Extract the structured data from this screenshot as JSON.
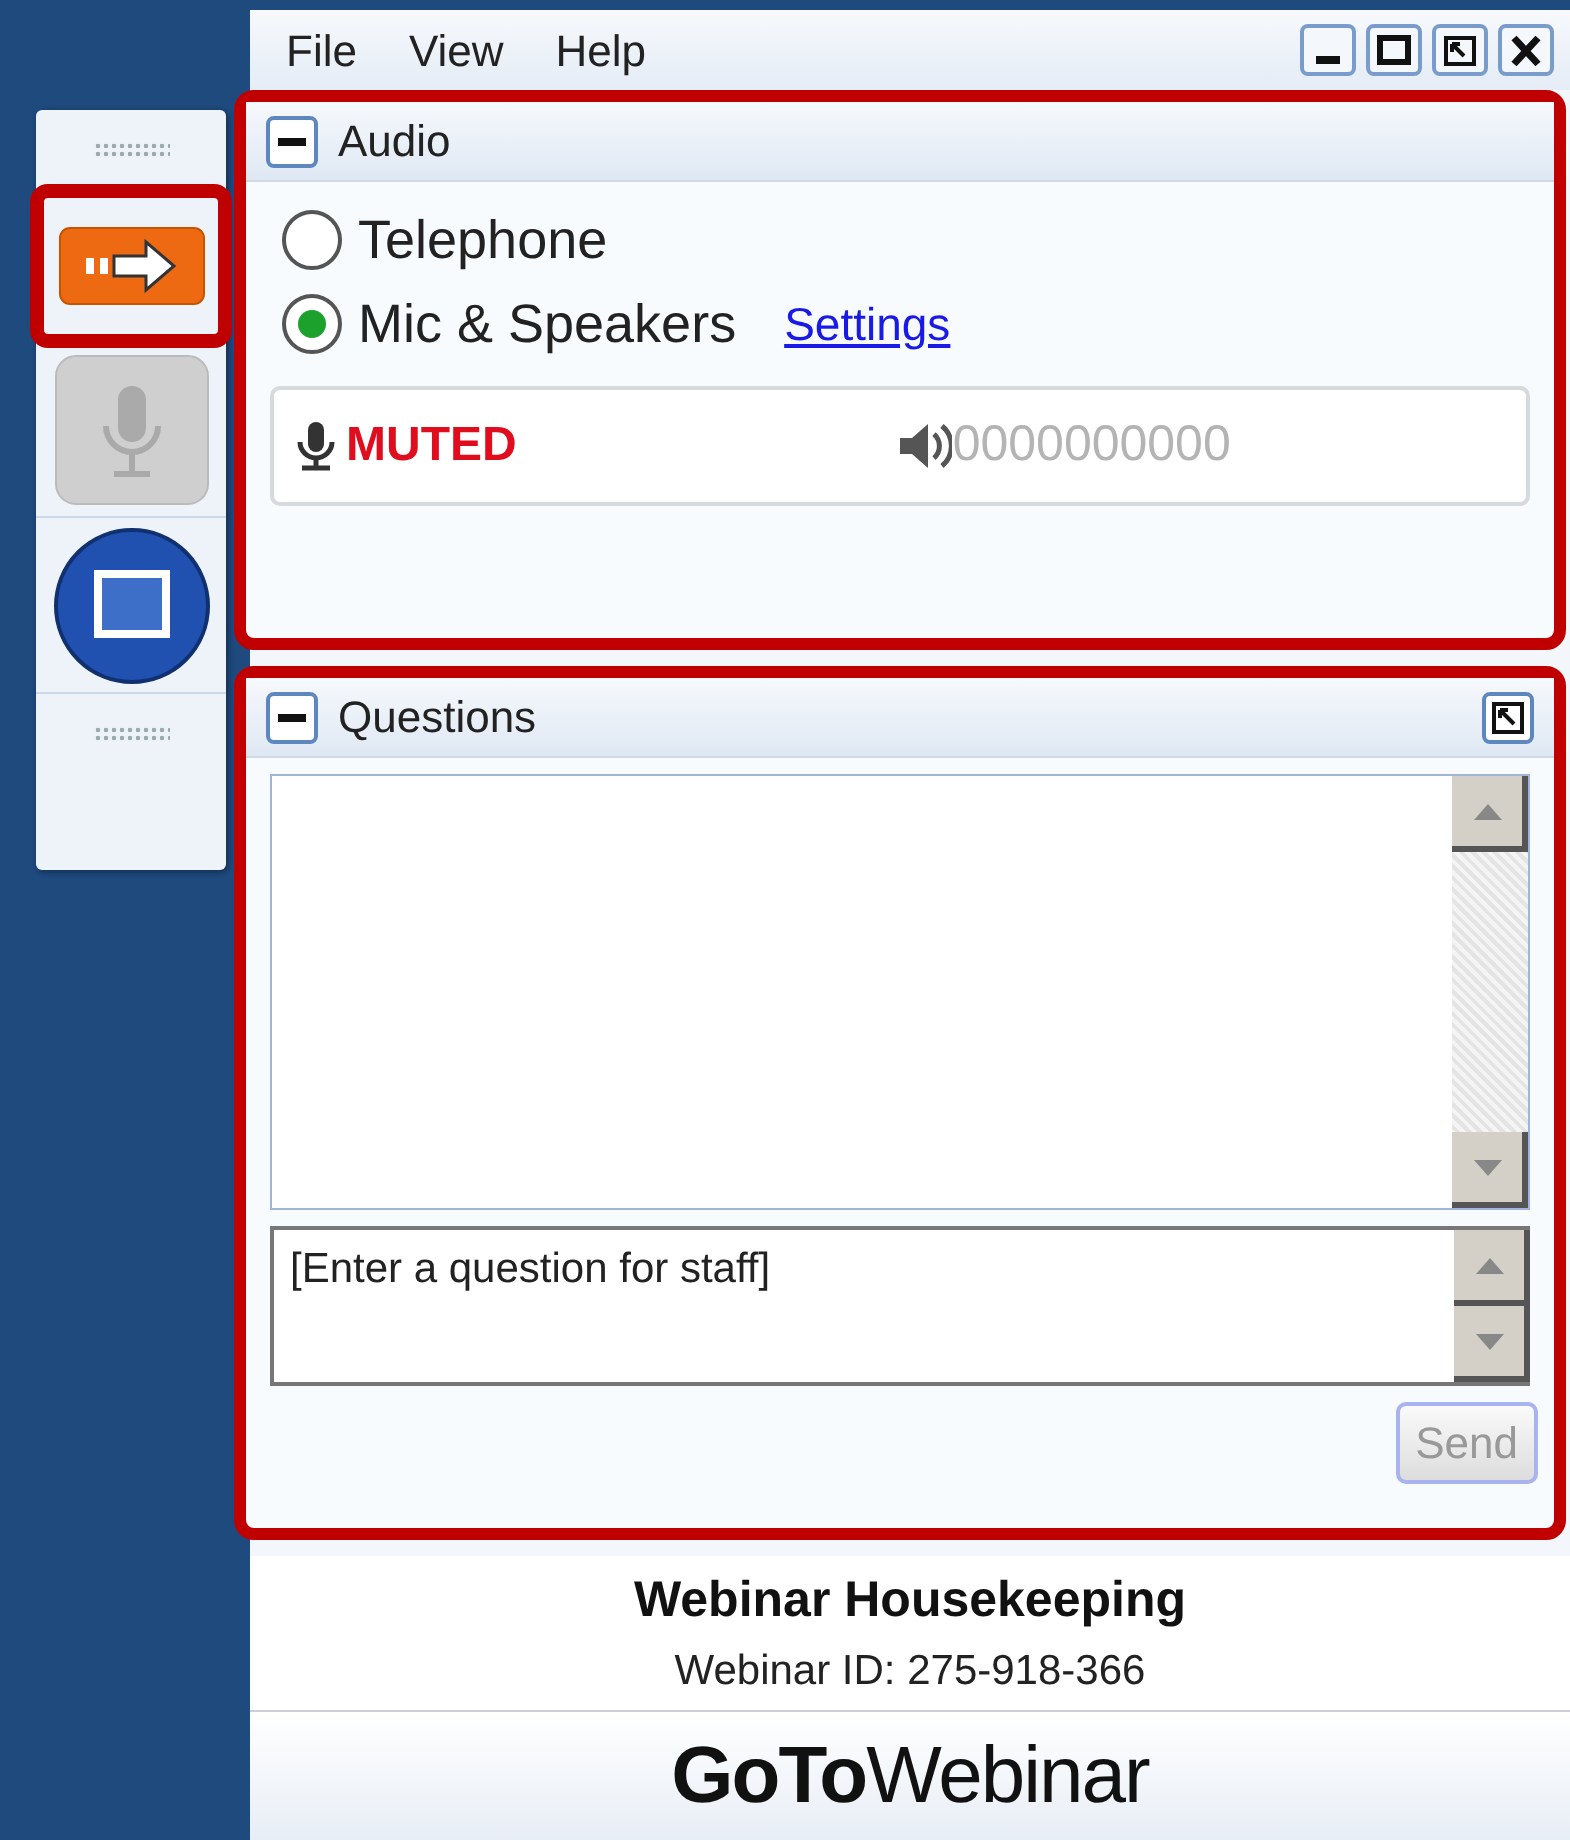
{
  "toolbar": {
    "buttons": [
      {
        "kind": "arrow",
        "highlighted": true,
        "disabled": false
      },
      {
        "kind": "mic",
        "disabled": true
      },
      {
        "kind": "screen",
        "disabled": false
      }
    ]
  },
  "menu": [
    "File",
    "View",
    "Help"
  ],
  "audio": {
    "title": "Audio",
    "highlighted": true,
    "options": [
      {
        "label": "Telephone",
        "selected": false
      },
      {
        "label": "Mic & Speakers",
        "selected": true
      }
    ],
    "settings_link": "Settings",
    "mic_status": "MUTED",
    "speaker_level": "0000000000"
  },
  "questions": {
    "title": "Questions",
    "highlighted": true,
    "placeholder": "[Enter a question for staff]",
    "send": {
      "label": "Send",
      "disabled": true
    }
  },
  "footer": {
    "title": "Webinar Housekeeping",
    "webinar_id": "Webinar ID: 275-918-366",
    "logo": "**GoTo**Webinar"
  }
}
